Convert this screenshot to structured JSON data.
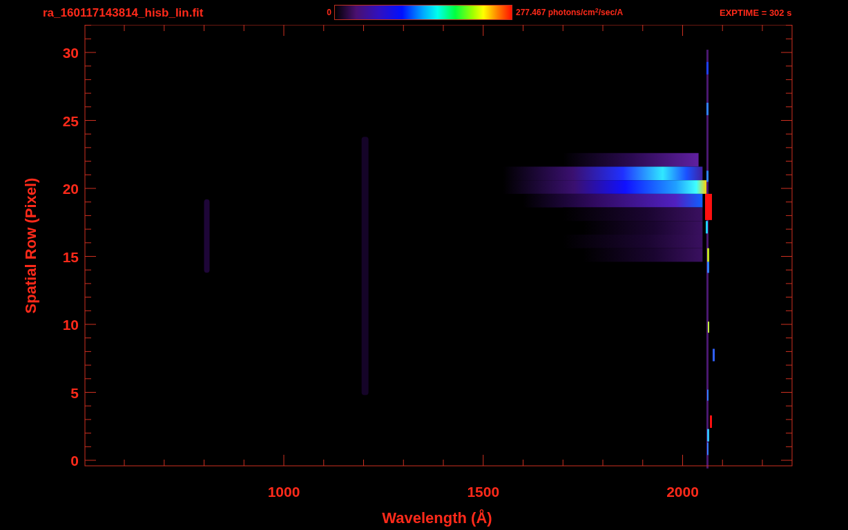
{
  "header": {
    "file_name": "ra_160117143814_hisb_lin.fit",
    "colorbar": {
      "min_label": "0",
      "max_label": "277.467 photons/cm$^{2}$/sec/A"
    },
    "exposure": "EXPTIME = 302 s"
  },
  "plot": {
    "xlabel": "Wavelength (Å)",
    "ylabel": "Spatial Row (Pixel)",
    "xticks": [
      "1000",
      "1500",
      "2000"
    ],
    "yticks": [
      "30",
      "25",
      "20",
      "15",
      "10",
      "5",
      "0"
    ]
  }
}
